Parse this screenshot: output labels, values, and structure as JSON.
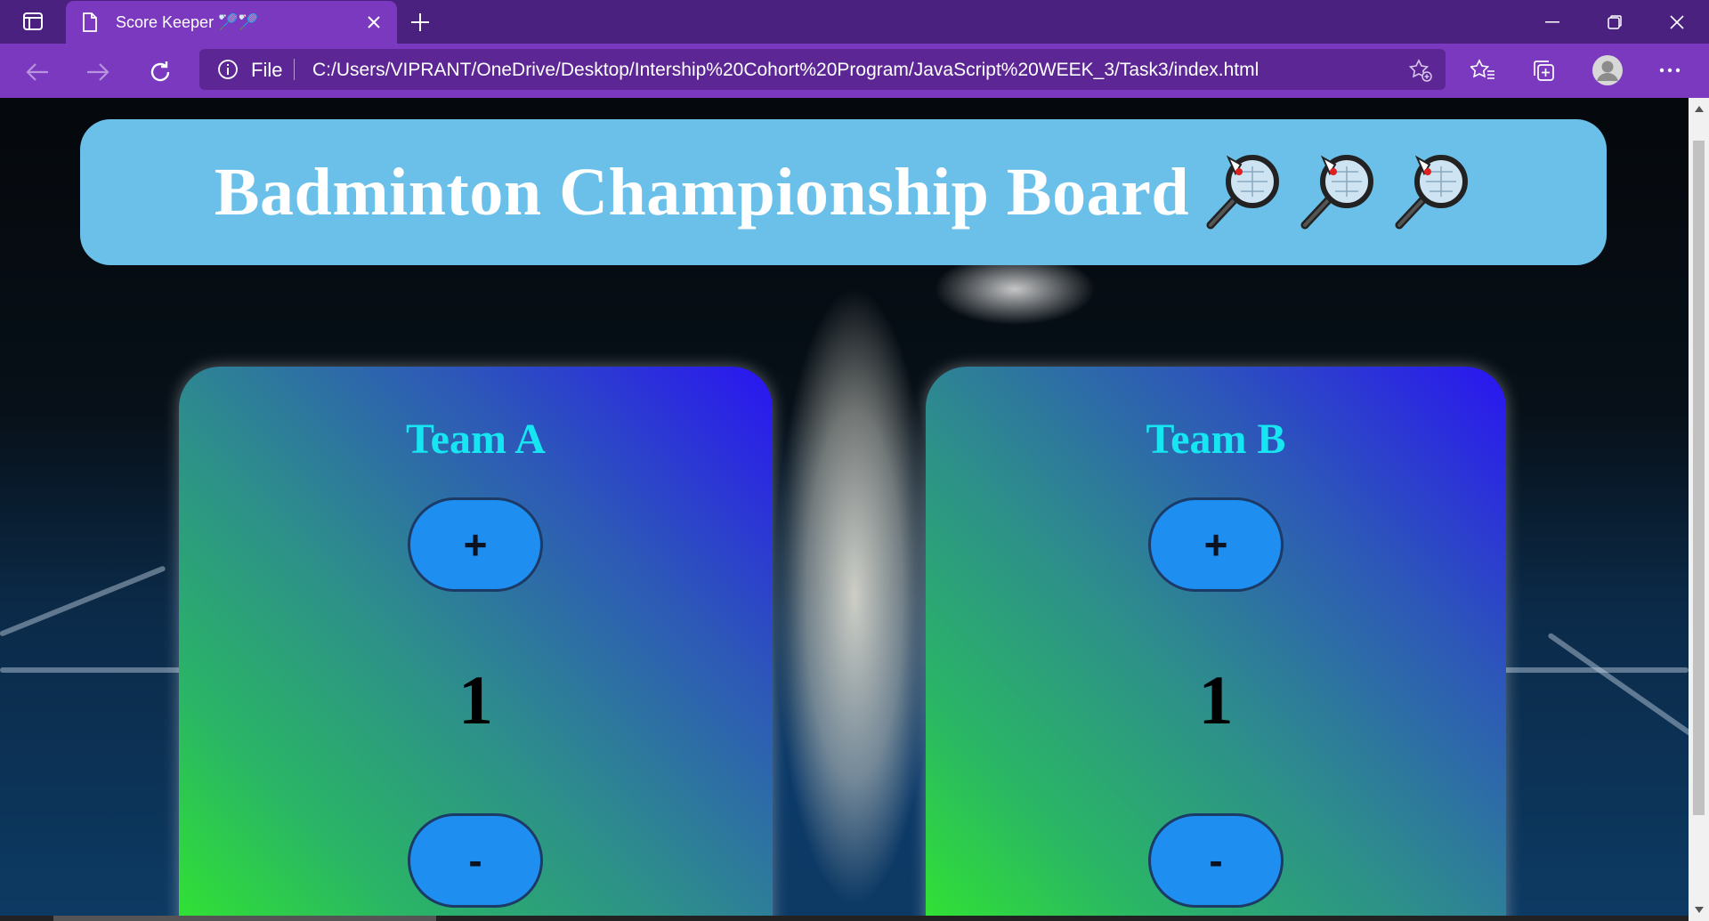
{
  "browser": {
    "tab_title": "Score Keeper 🏸🏸",
    "address_scheme": "File",
    "url": "C:/Users/VIPRANT/OneDrive/Desktop/Intership%20Cohort%20Program/JavaScript%20WEEK_3/Task3/index.html",
    "colors": {
      "titlebar": "#4b2180",
      "toolbar": "#7a39be"
    },
    "icons": [
      "tab-actions-icon",
      "page-icon",
      "close-icon",
      "new-tab-icon",
      "back-icon",
      "forward-icon",
      "refresh-icon",
      "info-icon",
      "add-favorite-icon",
      "favorites-icon",
      "collections-icon",
      "profile-avatar",
      "more-icon",
      "minimize-icon",
      "restore-icon",
      "window-close-icon"
    ]
  },
  "page": {
    "header_title": "Badminton Championship Board",
    "colors": {
      "banner": "#6bc0ea",
      "team_name": "#16e6f2",
      "button": "#1f8ef1"
    },
    "teams": [
      {
        "name": "Team A",
        "plus_label": "+",
        "minus_label": "-",
        "score": "1"
      },
      {
        "name": "Team B",
        "plus_label": "+",
        "minus_label": "-",
        "score": "1"
      }
    ]
  }
}
